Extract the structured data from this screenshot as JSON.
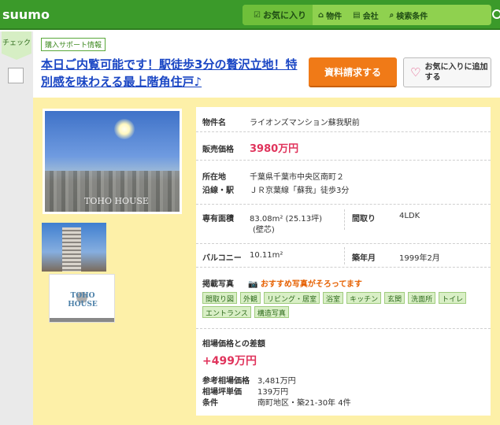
{
  "header": {
    "logo": "suumo",
    "nav": [
      {
        "label": "お気に入り",
        "icon": "checkbox-icon"
      },
      {
        "label": "物件",
        "icon": "home-icon"
      },
      {
        "label": "会社",
        "icon": "building-icon"
      },
      {
        "label": "検索条件",
        "icon": "search-icon"
      }
    ]
  },
  "left": {
    "check_label": "チェック"
  },
  "listing": {
    "badge": "購入サポート情報",
    "title": "本日ご内覧可能です！駅徒歩3分の贅沢立地！特別感を味わえる最上階角住戸♪",
    "request_button": "資料請求する",
    "favorite_button": "お気に入りに追加する",
    "photo_watermark": "TOHO HOUSE",
    "video_logo": "TOHO HOUSE"
  },
  "details": {
    "name_label": "物件名",
    "name": "ライオンズマンション蘇我駅前",
    "price_label": "販売価格",
    "price": "3980万円",
    "address_label": "所在地",
    "address": "千葉県千葉市中央区南町２",
    "line_label": "沿線・駅",
    "line": "ＪＲ京葉線「蘇我」徒歩3分",
    "area_label": "専有面積",
    "area": "83.08m² (25.13坪)",
    "area_note": "(壁芯)",
    "layout_label": "間取り",
    "layout": "4LDK",
    "balcony_label": "バルコニー",
    "balcony": "10.11m²",
    "built_label": "築年月",
    "built": "1999年2月",
    "photos_label": "掲載写真",
    "photos_note": "おすすめ写真がそろってます",
    "photo_tags": [
      "間取り図",
      "外観",
      "リビング・居室",
      "浴室",
      "キッチン",
      "玄関",
      "洗面所",
      "トイレ",
      "エントランス",
      "構造写真"
    ],
    "market_label": "相場価格との差額",
    "diff": "+499万円",
    "ref_price_label": "参考相場価格",
    "ref_price": "3,481万円",
    "ref_unit_label": "相場坪単価",
    "ref_unit": "139万円",
    "cond_label": "条件",
    "cond": "南町地区・築21-30年 4件"
  }
}
